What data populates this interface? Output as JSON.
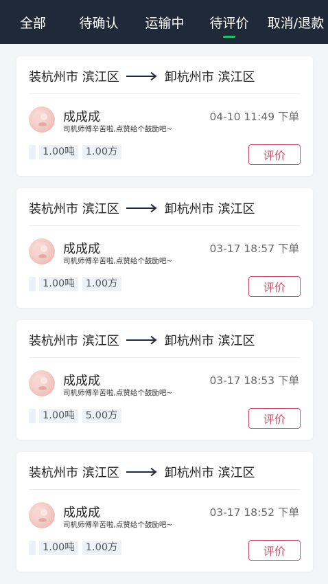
{
  "tabs": [
    {
      "label": "全部",
      "active": false
    },
    {
      "label": "待确认",
      "active": false
    },
    {
      "label": "运输中",
      "active": false
    },
    {
      "label": "待评价",
      "active": true
    },
    {
      "label": "取消/退款",
      "active": false
    }
  ],
  "colors": {
    "tabbar_bg": "#1f2937",
    "active_indicator": "#22c55e",
    "rate_button": "#d9456a",
    "page_bg": "#f4f5f7"
  },
  "orders": [
    {
      "load": "装杭州市 滨江区",
      "unload": "卸杭州市 滨江区",
      "driver_name": "成成成",
      "message": "司机师傅辛苦啦,点赞给个鼓励吧~",
      "time": "04-10 11:49 下单",
      "weight": "1.00吨",
      "volume": "1.00方",
      "rate_label": "评价"
    },
    {
      "load": "装杭州市 滨江区",
      "unload": "卸杭州市 滨江区",
      "driver_name": "成成成",
      "message": "司机师傅辛苦啦,点赞给个鼓励吧~",
      "time": "03-17 18:57 下单",
      "weight": "1.00吨",
      "volume": "1.00方",
      "rate_label": "评价"
    },
    {
      "load": "装杭州市 滨江区",
      "unload": "卸杭州市 滨江区",
      "driver_name": "成成成",
      "message": "司机师傅辛苦啦,点赞给个鼓励吧~",
      "time": "03-17 18:53 下单",
      "weight": "1.00吨",
      "volume": "5.00方",
      "rate_label": "评价"
    },
    {
      "load": "装杭州市 滨江区",
      "unload": "卸杭州市 滨江区",
      "driver_name": "成成成",
      "message": "司机师傅辛苦啦,点赞给个鼓励吧~",
      "time": "03-17 18:52 下单",
      "weight": "1.00吨",
      "volume": "1.00方",
      "rate_label": "评价"
    }
  ]
}
